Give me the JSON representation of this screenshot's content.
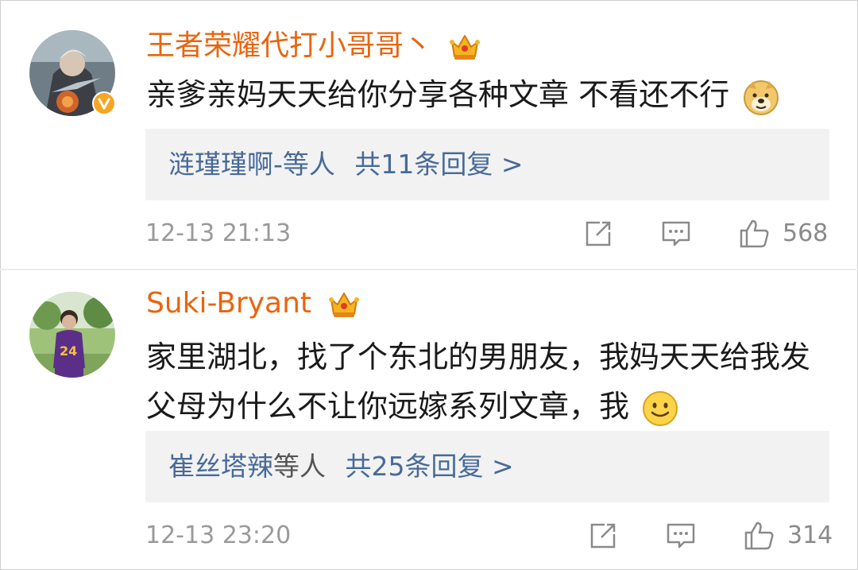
{
  "comments": [
    {
      "username": "王者荣耀代打小哥哥",
      "username_suffix": "丶",
      "text_lines": [
        "亲爹亲妈天天给你分享各种文章 不看还不行"
      ],
      "reply_users": "涟瑾瑾啊-等人",
      "reply_count": "共11条回复 >",
      "time": "12-13 21:13",
      "likes": "568",
      "verified_badge": true,
      "emoji": "doge-emoji"
    },
    {
      "username": "Suki-Bryant",
      "username_suffix": "",
      "text_lines": [
        "家里湖北，找了个东北的男朋友，我妈天天给我发",
        "父母为什么不让你远嫁系列文章，我"
      ],
      "reply_users": "崔丝塔辣",
      "reply_users_suffix": "等人",
      "reply_count": "共25条回复 >",
      "time": "12-13 23:20",
      "likes": "314",
      "verified_badge": false,
      "emoji": "smile-emoji"
    }
  ],
  "colors": {
    "username": "#e8650f",
    "link": "#476a99",
    "reply_bg": "#f2f2f2",
    "meta": "#9a9a9a",
    "badge": "#f5a623"
  },
  "icons": [
    "share-icon",
    "comment-icon",
    "like-icon",
    "crown-icon",
    "verified-badge-icon"
  ]
}
